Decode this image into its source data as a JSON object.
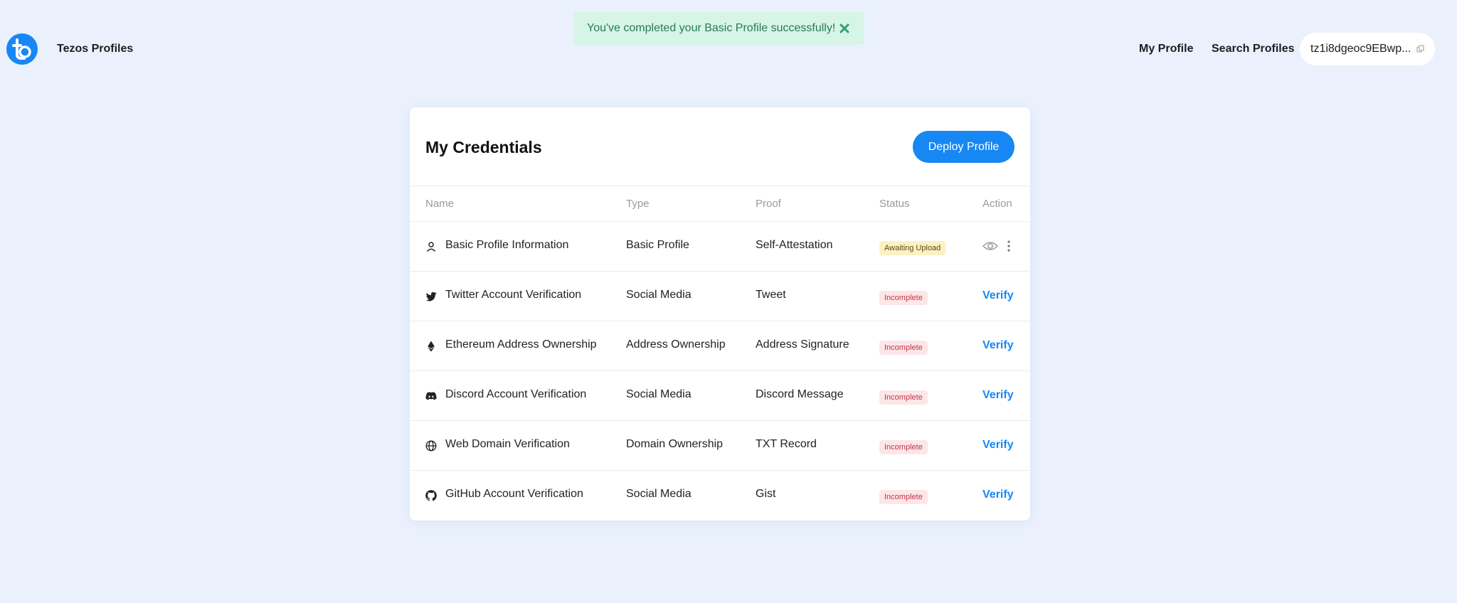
{
  "header": {
    "brand": "Tezos Profiles",
    "nav": {
      "my_profile": "My Profile",
      "search_profiles": "Search Profiles"
    },
    "wallet_address": "tz1i8dgeoc9EBwp..."
  },
  "toast": {
    "message": "You've completed your Basic Profile successfully!"
  },
  "credentials": {
    "title": "My Credentials",
    "deploy_label": "Deploy Profile",
    "columns": {
      "name": "Name",
      "type": "Type",
      "proof": "Proof",
      "status": "Status",
      "action": "Action"
    },
    "rows": [
      {
        "icon": "user-icon",
        "name": "Basic Profile Information",
        "type": "Basic Profile",
        "proof": "Self-Attestation",
        "status": "Awaiting Upload"
      },
      {
        "icon": "twitter-icon",
        "name": "Twitter Account Verification",
        "type": "Social Media",
        "proof": "Tweet",
        "status": "Incomplete",
        "action": "Verify"
      },
      {
        "icon": "ethereum-icon",
        "name": "Ethereum Address Ownership",
        "type": "Address Ownership",
        "proof": "Address Signature",
        "status": "Incomplete",
        "action": "Verify"
      },
      {
        "icon": "discord-icon",
        "name": "Discord Account Verification",
        "type": "Social Media",
        "proof": "Discord Message",
        "status": "Incomplete",
        "action": "Verify"
      },
      {
        "icon": "globe-icon",
        "name": "Web Domain Verification",
        "type": "Domain Ownership",
        "proof": "TXT Record",
        "status": "Incomplete",
        "action": "Verify"
      },
      {
        "icon": "github-icon",
        "name": "GitHub Account Verification",
        "type": "Social Media",
        "proof": "Gist",
        "status": "Incomplete",
        "action": "Verify"
      }
    ]
  },
  "colors": {
    "background": "#eaf1fd",
    "accent": "#1787f4",
    "toast_bg": "#d6f5e6",
    "toast_text": "#2a7a55",
    "badge_awaiting_bg": "#fcf1c5",
    "badge_incomplete_bg": "#fde6e8",
    "badge_incomplete_text": "#c03646"
  }
}
